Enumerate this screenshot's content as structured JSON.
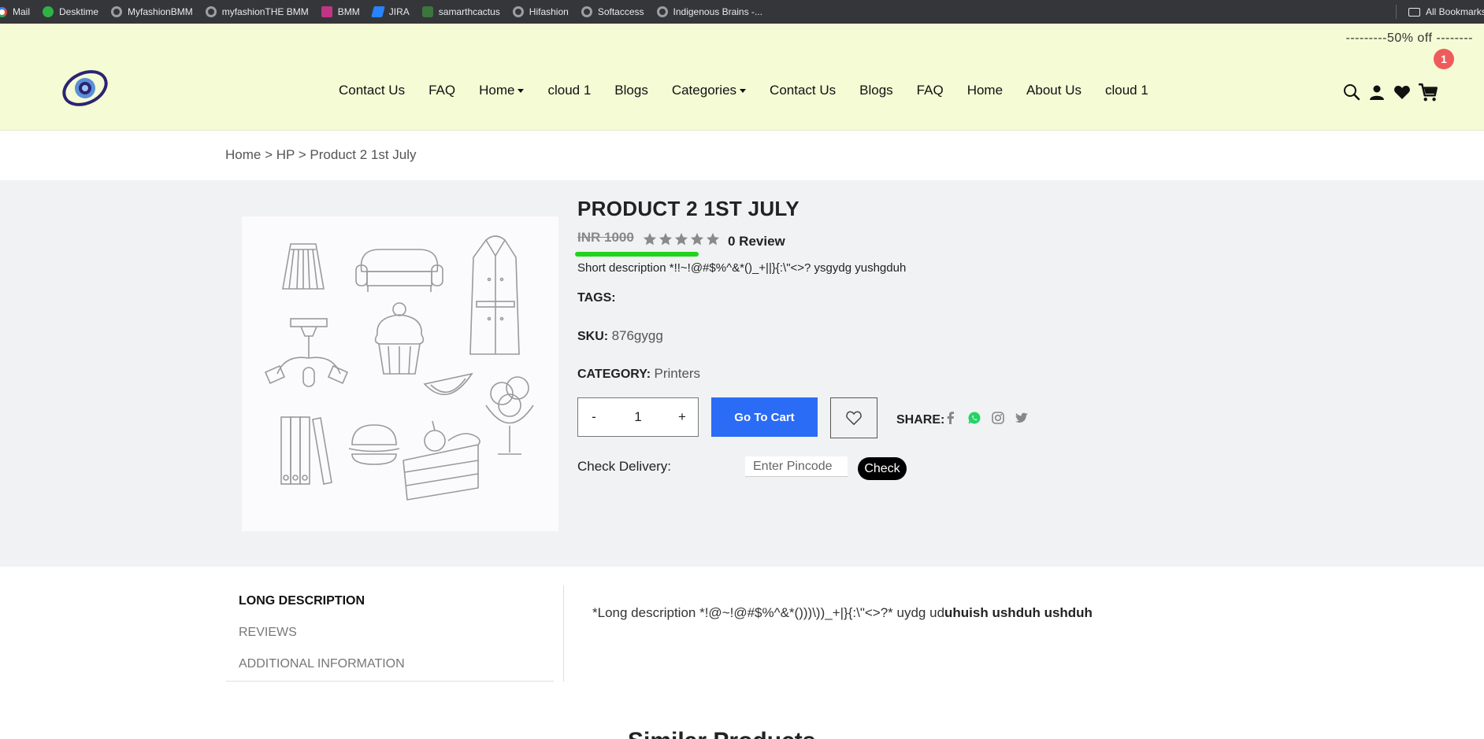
{
  "bookmarks": {
    "items": [
      {
        "label": "Mail",
        "icon": "google-icon"
      },
      {
        "label": "Desktime",
        "icon": "desktime-icon"
      },
      {
        "label": "MyfashionBMM",
        "icon": "globe-icon"
      },
      {
        "label": "myfashionTHE BMM",
        "icon": "globe-icon"
      },
      {
        "label": "BMM",
        "icon": "bmm-icon"
      },
      {
        "label": "JIRA",
        "icon": "jira-icon"
      },
      {
        "label": "samarthcactus",
        "icon": "cactus-icon"
      },
      {
        "label": "Hifashion",
        "icon": "globe-icon"
      },
      {
        "label": "Softaccess",
        "icon": "globe-icon"
      },
      {
        "label": "Indigenous Brains -...",
        "icon": "globe-icon"
      }
    ],
    "all_bookmarks": "All Bookmarks"
  },
  "header": {
    "promo": "---------50% off --------",
    "nav": [
      {
        "label": "Contact Us",
        "dropdown": false
      },
      {
        "label": "FAQ",
        "dropdown": false
      },
      {
        "label": "Home",
        "dropdown": true
      },
      {
        "label": "cloud 1",
        "dropdown": false
      },
      {
        "label": "Blogs",
        "dropdown": false
      },
      {
        "label": "Categories",
        "dropdown": true
      },
      {
        "label": "Contact Us",
        "dropdown": false
      },
      {
        "label": "Blogs",
        "dropdown": false
      },
      {
        "label": "FAQ",
        "dropdown": false
      },
      {
        "label": "Home",
        "dropdown": false
      },
      {
        "label": "About Us",
        "dropdown": false
      },
      {
        "label": "cloud 1",
        "dropdown": false
      }
    ],
    "icons": [
      "search-icon",
      "user-icon",
      "heart-icon",
      "cart-icon"
    ],
    "cart_count": "1"
  },
  "breadcrumb": {
    "home": "Home",
    "category": "HP",
    "current": "Product 2 1st July",
    "separator": " > "
  },
  "product": {
    "title": "PRODUCT 2 1ST JULY",
    "price": "INR 1000",
    "rating": 0,
    "reviews": "0 Review",
    "short_description": "Short description *!!~!@#$%^&*()_+||}{:\\\"<>? ysgydg yushgduh",
    "tags_label": "TAGS:",
    "sku_label": "SKU:",
    "sku": "876gygg",
    "category_label": "CATEGORY:",
    "category": "Printers",
    "quantity": "1",
    "minus": "-",
    "plus": "+",
    "add_to_cart": "Go To Cart",
    "share_label": "SHARE:",
    "share_icons": [
      "facebook-icon",
      "whatsapp-icon",
      "instagram-icon",
      "twitter-icon"
    ],
    "delivery_label": "Check Delivery:",
    "pincode_placeholder": "Enter Pincode",
    "check_label": "Check"
  },
  "tabs": {
    "items": [
      "LONG DESCRIPTION",
      "REVIEWS",
      "ADDITIONAL INFORMATION"
    ],
    "active": 0,
    "long_description_normal": "*Long description *!@~!@#$%^&*()))\\))_+|}{:\\\"<>?* uydg ud",
    "long_description_bold": "uhuish ushduh ushduh"
  },
  "similar_title": "Similar Products",
  "colors": {
    "header_bg": "#f4fbd5",
    "cart_button": "#2a6cf6",
    "badge": "#ef5b5b",
    "highlight": "#22d31d",
    "section_bg": "#f1f2f4"
  }
}
